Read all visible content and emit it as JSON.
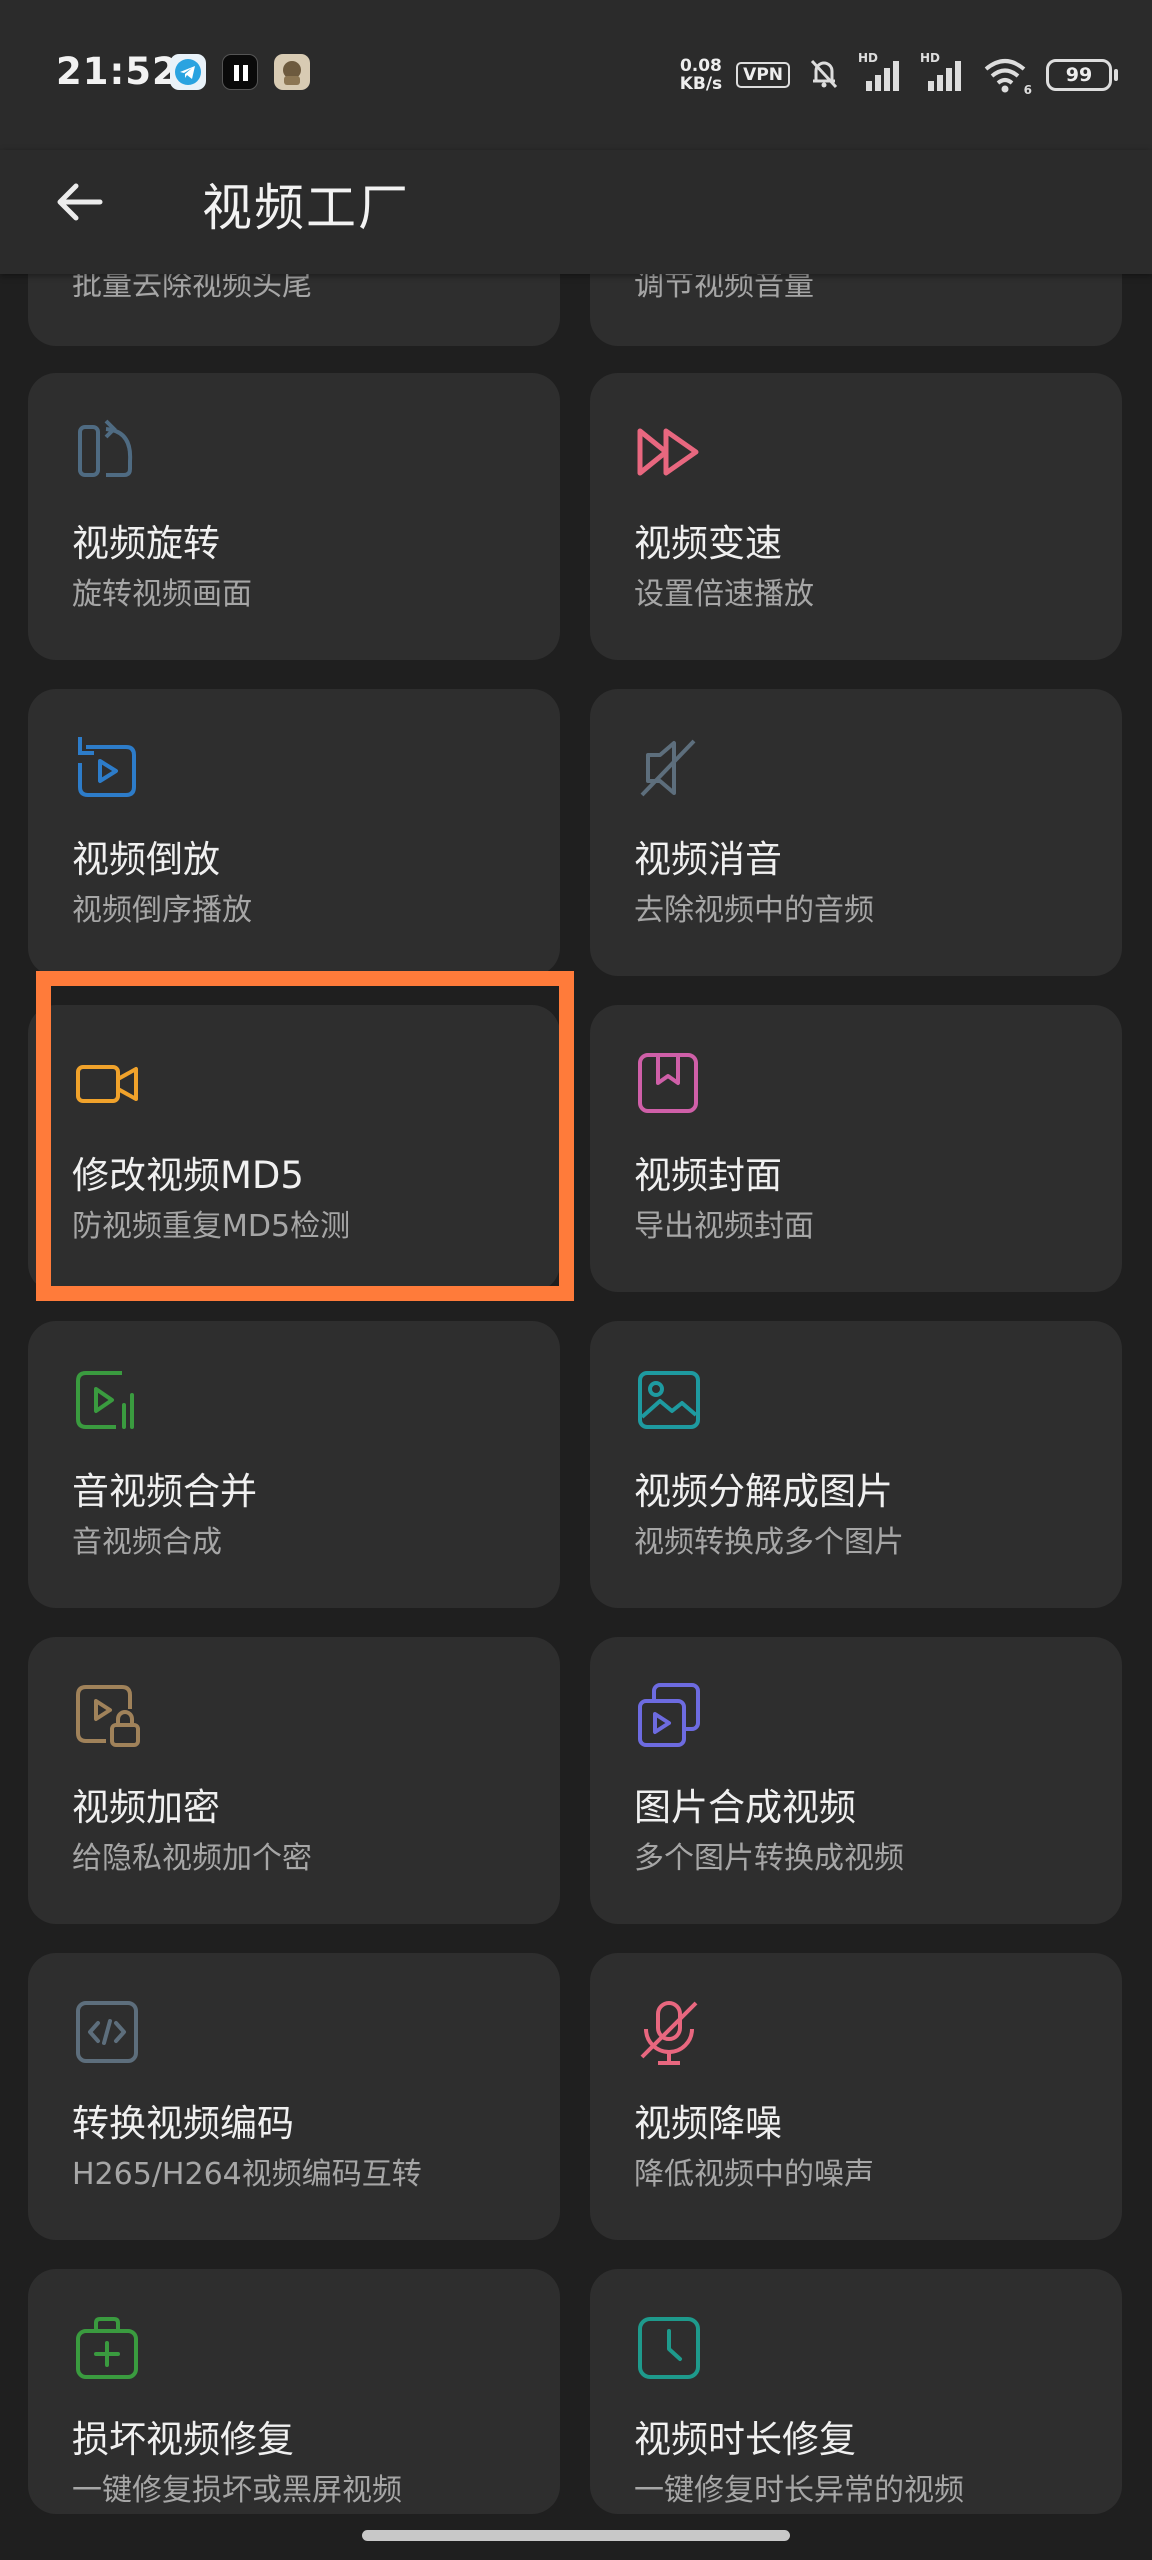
{
  "status_bar": {
    "time": "21:52",
    "net_speed_value": "0.08",
    "net_speed_unit": "KB/s",
    "vpn": "VPN",
    "signal1_label": "HD",
    "signal2_label": "HD",
    "wifi_badge": "6",
    "battery": "99"
  },
  "app_bar": {
    "title": "视频工厂",
    "back_icon": "arrow-left-icon"
  },
  "partial_cards": [
    {
      "desc": "批量去除视频头尾"
    },
    {
      "desc": "调节视频音量"
    }
  ],
  "tools": [
    {
      "name": "视频旋转",
      "desc": "旋转视频画面",
      "icon": "rotate-icon",
      "color": "#4f6b82"
    },
    {
      "name": "视频变速",
      "desc": "设置倍速播放",
      "icon": "fast-forward-icon",
      "color": "#e8677f"
    },
    {
      "name": "视频倒放",
      "desc": "视频倒序播放",
      "icon": "reverse-play-icon",
      "color": "#2d7cc9"
    },
    {
      "name": "视频消音",
      "desc": "去除视频中的音频",
      "icon": "mute-icon",
      "color": "#5d6e7c"
    },
    {
      "name": "修改视频MD5",
      "desc": "防视频重复MD5检测",
      "icon": "video-camera-icon",
      "color": "#f0a22b"
    },
    {
      "name": "视频封面",
      "desc": "导出视频封面",
      "icon": "cover-icon",
      "color": "#cf5fa8"
    },
    {
      "name": "音视频合并",
      "desc": "音视频合成",
      "icon": "audio-video-merge-icon",
      "color": "#3a9b3f"
    },
    {
      "name": "视频分解成图片",
      "desc": "视频转换成多个图片",
      "icon": "image-icon",
      "color": "#1e9aa0"
    },
    {
      "name": "视频加密",
      "desc": "给隐私视频加个密",
      "icon": "lock-video-icon",
      "color": "#a0825a"
    },
    {
      "name": "图片合成视频",
      "desc": "多个图片转换成视频",
      "icon": "images-to-video-icon",
      "color": "#6d6be0"
    },
    {
      "name": "转换视频编码",
      "desc": "H265/H264视频编码互转",
      "icon": "code-icon",
      "color": "#5d6e7c"
    },
    {
      "name": "视频降噪",
      "desc": "降低视频中的噪声",
      "icon": "mic-off-icon",
      "color": "#e8677f"
    },
    {
      "name": "损坏视频修复",
      "desc": "一键修复损坏或黑屏视频",
      "icon": "repair-kit-icon",
      "color": "#3a9b3f"
    },
    {
      "name": "视频时长修复",
      "desc": "一键修复时长异常的视频",
      "icon": "clock-icon",
      "color": "#1e9a8c"
    }
  ],
  "highlighted_tool": "修改视频MD5",
  "highlight_color": "#ff7b3a"
}
